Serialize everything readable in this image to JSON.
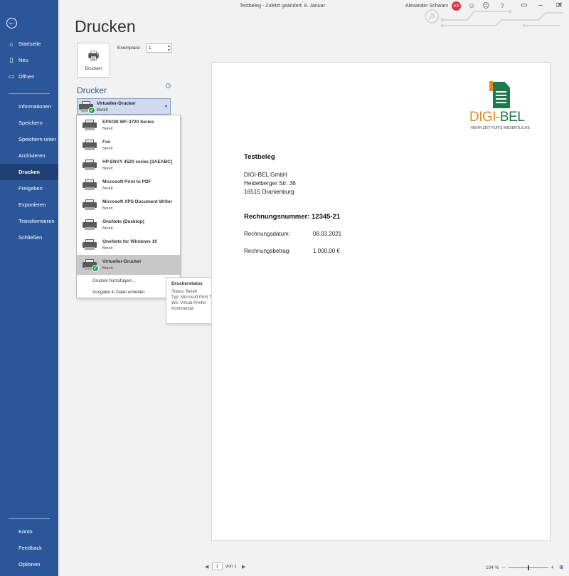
{
  "window": {
    "title": "Testbeleg  -  Zuletzt geändert: 8. Januar",
    "user_name": "Alexander Schwarz",
    "user_initials": "AS"
  },
  "sidebar": {
    "top_items": [
      {
        "label": "Startseite",
        "icon": "home-icon"
      },
      {
        "label": "Neu",
        "icon": "new-document-icon"
      },
      {
        "label": "Öffnen",
        "icon": "folder-open-icon"
      }
    ],
    "mid_items": [
      {
        "label": "Informationen"
      },
      {
        "label": "Speichern"
      },
      {
        "label": "Speichern unter"
      },
      {
        "label": "Archivieren"
      },
      {
        "label": "Drucken"
      },
      {
        "label": "Freigeben"
      },
      {
        "label": "Exportieren"
      },
      {
        "label": "Transformieren"
      },
      {
        "label": "Schließen"
      }
    ],
    "bottom_items": [
      {
        "label": "Konto"
      },
      {
        "label": "Feedback"
      },
      {
        "label": "Optionen"
      }
    ],
    "active_item": "Drucken",
    "color": "#2b579a"
  },
  "print": {
    "page_title": "Drucken",
    "print_button_label": "Drucken",
    "copies_label": "Exemplare:",
    "copies_value": "1",
    "printer_section_label": "Drucker",
    "selected_printer": {
      "name": "Virtueller-Drucker",
      "status": "Bereit"
    }
  },
  "printers": [
    {
      "name": "EPSON WF-3720 Series",
      "status": "Bereit"
    },
    {
      "name": "Fax",
      "status": "Bereit"
    },
    {
      "name": "HP ENVY 4520 series [3AEABC]",
      "status": "Bereit"
    },
    {
      "name": "Microsoft Print to PDF",
      "status": "Bereit"
    },
    {
      "name": "Microsoft XPS Document Writer",
      "status": "Bereit"
    },
    {
      "name": "OneNote (Desktop)",
      "status": "Bereit"
    },
    {
      "name": "OneNote for Windows 10",
      "status": "Bereit"
    },
    {
      "name": "Virtueller-Drucker",
      "status": "Bereit"
    }
  ],
  "dropdown_links": {
    "add_printer": "Drucker hinzufügen...",
    "print_to_file": "Ausgabe in Datei umleiten"
  },
  "tooltip": {
    "title": "Druckerstatus",
    "lines": [
      "Status: Bereit",
      "Typ: Microsoft Print To PDF",
      "Wo: Virtual-Printer",
      "Kommentar:"
    ]
  },
  "document": {
    "logo_part1": "DIGI-",
    "logo_part2": "BEL",
    "logo_tagline": "MEHR ZEIT FÜR'S WESENTLICHE",
    "title": "Testbeleg",
    "address": [
      "DIGI-BEL GmbH",
      "Heidelberger Str. 36",
      "16515 Oranienburg"
    ],
    "invoice_number": "Rechnungsnummer: 12345-21",
    "date_label": "Rechnungsdatum:",
    "date_value": "08.03.2021",
    "amount_label": "Rechnungsbetrag:",
    "amount_value": "1.000,00 €"
  },
  "footer": {
    "page_current": "1",
    "page_of": "von 1",
    "zoom": "104 %"
  },
  "colors": {
    "accent": "#2b579a",
    "logo_orange": "#e7891d",
    "logo_green": "#1d7a4a",
    "avatar": "#d9363e"
  }
}
